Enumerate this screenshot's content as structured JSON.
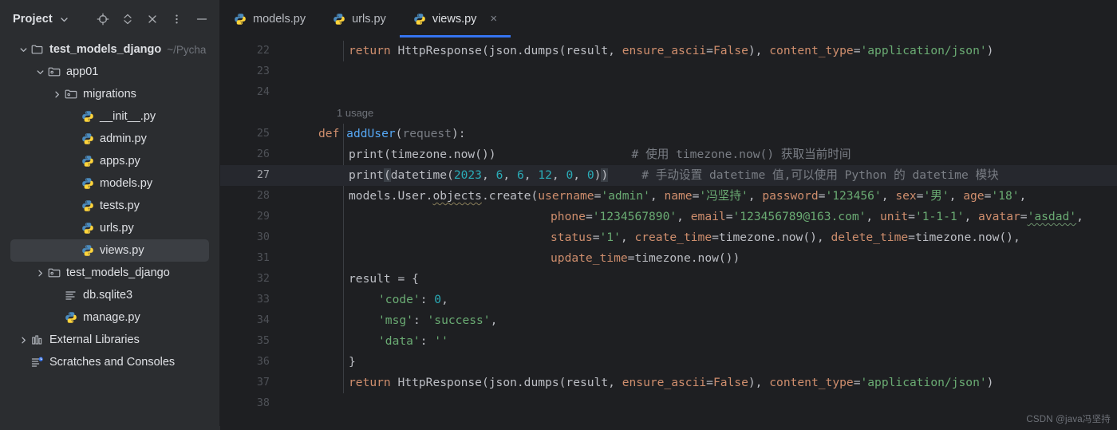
{
  "sidebar": {
    "panel_title": "Project",
    "header_icons": [
      {
        "name": "scroll-from-source-icon",
        "glyph": "target"
      },
      {
        "name": "expand-collapse-icon",
        "glyph": "chevrons"
      },
      {
        "name": "collapse-all-icon",
        "glyph": "x"
      },
      {
        "name": "more-options-icon",
        "glyph": "dots"
      },
      {
        "name": "minimize-panel-icon",
        "glyph": "dash"
      }
    ],
    "tree": [
      {
        "label": "test_models_django",
        "sub": "~/Pycha",
        "icon": "folder-project",
        "arrow": "down",
        "indent": 0,
        "bold": true,
        "selected": false
      },
      {
        "label": "app01",
        "sub": "",
        "icon": "folder-module",
        "arrow": "down",
        "indent": 1,
        "bold": false,
        "selected": false
      },
      {
        "label": "migrations",
        "sub": "",
        "icon": "folder-module",
        "arrow": "right",
        "indent": 2,
        "bold": false,
        "selected": false
      },
      {
        "label": "__init__.py",
        "sub": "",
        "icon": "python",
        "arrow": "none",
        "indent": 3,
        "bold": false,
        "selected": false
      },
      {
        "label": "admin.py",
        "sub": "",
        "icon": "python",
        "arrow": "none",
        "indent": 3,
        "bold": false,
        "selected": false
      },
      {
        "label": "apps.py",
        "sub": "",
        "icon": "python",
        "arrow": "none",
        "indent": 3,
        "bold": false,
        "selected": false
      },
      {
        "label": "models.py",
        "sub": "",
        "icon": "python",
        "arrow": "none",
        "indent": 3,
        "bold": false,
        "selected": false
      },
      {
        "label": "tests.py",
        "sub": "",
        "icon": "python",
        "arrow": "none",
        "indent": 3,
        "bold": false,
        "selected": false
      },
      {
        "label": "urls.py",
        "sub": "",
        "icon": "python",
        "arrow": "none",
        "indent": 3,
        "bold": false,
        "selected": false
      },
      {
        "label": "views.py",
        "sub": "",
        "icon": "python",
        "arrow": "none",
        "indent": 3,
        "bold": false,
        "selected": true
      },
      {
        "label": "test_models_django",
        "sub": "",
        "icon": "folder-module",
        "arrow": "right",
        "indent": 1,
        "bold": false,
        "selected": false
      },
      {
        "label": "db.sqlite3",
        "sub": "",
        "icon": "db",
        "arrow": "none",
        "indent": 2,
        "bold": false,
        "selected": false
      },
      {
        "label": "manage.py",
        "sub": "",
        "icon": "python",
        "arrow": "none",
        "indent": 2,
        "bold": false,
        "selected": false
      },
      {
        "label": "External Libraries",
        "sub": "",
        "icon": "library",
        "arrow": "right",
        "indent": 0,
        "bold": false,
        "selected": false
      },
      {
        "label": "Scratches and Consoles",
        "sub": "",
        "icon": "scratch",
        "arrow": "none",
        "indent": 0,
        "bold": false,
        "selected": false
      }
    ]
  },
  "tabs": [
    {
      "label": "models.py",
      "active": false,
      "closable": false
    },
    {
      "label": "urls.py",
      "active": false,
      "closable": false
    },
    {
      "label": "views.py",
      "active": true,
      "closable": true,
      "close_glyph": "×"
    }
  ],
  "editor": {
    "first_line": 22,
    "line_numbers": [
      22,
      23,
      24,
      null,
      25,
      26,
      27,
      28,
      29,
      30,
      31,
      32,
      33,
      34,
      35,
      36,
      37,
      38
    ],
    "current_line": 27,
    "usage_hint": "1 usage",
    "intention_icon": "lightbulb-icon",
    "lines": {
      "l22": "        return HttpResponse(json.dumps(result, ensure_ascii=False), content_type='application/json')",
      "l25": "def addUser(request):",
      "l26": "    print(timezone.now())",
      "l26_comment": "# 使用 timezone.now() 获取当前时间",
      "l27": "    print(datetime(2023, 6, 6, 12, 0, 0))",
      "l27_comment": "# 手动设置 datetime 值,可以使用 Python 的 datetime 模块",
      "l28": "    models.User.objects.create(username='admin', name='冯坚持', password='123456', sex='男', age='18',",
      "l29": "                               phone='1234567890', email='123456789@163.com', unit='1-1-1', avatar='asdad',",
      "l30": "                               status='1', create_time=timezone.now(), delete_time=timezone.now(),",
      "l31": "                               update_time=timezone.now())",
      "l32": "    result = {",
      "l33": "        'code': 0,",
      "l34": "        'msg': 'success',",
      "l35": "        'data': ''",
      "l36": "    }",
      "l37": "    return HttpResponse(json.dumps(result, ensure_ascii=False), content_type='application/json')"
    },
    "tokens": {
      "kw_return": "return",
      "kw_def": "def",
      "fn_addUser": "addUser",
      "fn_print": "print",
      "id_request": "request",
      "id_HttpResponse": "HttpResponse",
      "id_json_dumps": "json.dumps",
      "id_result": "result",
      "arg_ensure_ascii": "ensure_ascii",
      "val_False": "False",
      "arg_content_type": "content_type",
      "str_application_json": "'application/json'",
      "id_timezone_now": "timezone.now()",
      "fn_datetime": "datetime",
      "nums_datetime": [
        "2023",
        "6",
        "6",
        "12",
        "0",
        "0"
      ],
      "id_models_user": "models.User.",
      "id_objects": "objects",
      "fn_create": "create",
      "kwargs": [
        {
          "name": "username",
          "value": "'admin'"
        },
        {
          "name": "name",
          "value": "'冯坚持'"
        },
        {
          "name": "password",
          "value": "'123456'"
        },
        {
          "name": "sex",
          "value": "'男'"
        },
        {
          "name": "age",
          "value": "'18'"
        },
        {
          "name": "phone",
          "value": "'1234567890'"
        },
        {
          "name": "email",
          "value": "'123456789@163.com'"
        },
        {
          "name": "unit",
          "value": "'1-1-1'"
        },
        {
          "name": "avatar",
          "value": "'asdad'"
        },
        {
          "name": "status",
          "value": "'1'"
        },
        {
          "name": "create_time",
          "value": "timezone.now()"
        },
        {
          "name": "delete_time",
          "value": "timezone.now()"
        },
        {
          "name": "update_time",
          "value": "timezone.now()"
        }
      ],
      "dict_keys": [
        "'code'",
        "'msg'",
        "'data'"
      ],
      "dict_vals": [
        "0",
        "'success'",
        "''"
      ],
      "id_result_assign": "result"
    }
  },
  "watermark": "CSDN @java冯坚持",
  "colors": {
    "accent": "#3574f0",
    "editor_bg": "#1e1f22",
    "sidebar_bg": "#2b2d30",
    "selection": "#3b3e43",
    "keyword": "#cf8e6d",
    "string": "#6aab73",
    "number": "#2aacb8",
    "function": "#56a8f5",
    "comment": "#7a7e85",
    "text": "#bcbec4"
  }
}
